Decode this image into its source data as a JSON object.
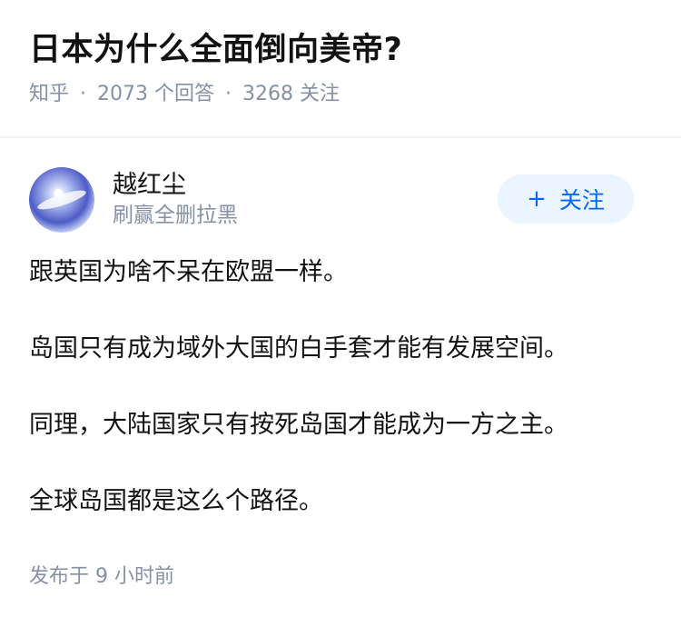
{
  "question": {
    "title": "日本为什么全面倒向美帝?",
    "source": "知乎",
    "separator": "·",
    "answers": "2073 个回答",
    "followers": "3268 关注"
  },
  "answer": {
    "author_name": "越红尘",
    "author_bio": "刷赢全删拉黑",
    "follow_plus": "+",
    "follow_label": "关注",
    "paragraphs": [
      "跟英国为啥不呆在欧盟一样。",
      "岛国只有成为域外大国的白手套才能有发展空间。",
      "同理，大陆国家只有按死岛国才能成为一方之主。",
      "全球岛国都是这么个路径。"
    ],
    "published": "发布于 9 小时前"
  },
  "colors": {
    "accent": "#0066ff",
    "follow_bg": "#ebf5ff",
    "meta_text": "#8590a6",
    "body_text": "#121212"
  },
  "icons": {
    "avatar": "bird-avatar"
  }
}
